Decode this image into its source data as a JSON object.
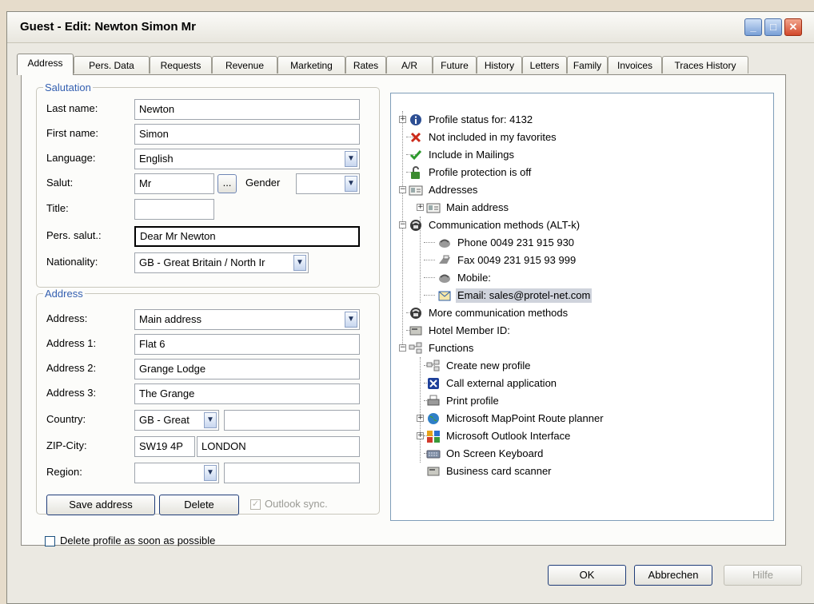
{
  "window": {
    "title": "Guest - Edit: Newton Simon Mr"
  },
  "tabs": [
    "Address",
    "Pers. Data",
    "Requests",
    "Revenue",
    "Marketing",
    "Rates",
    "A/R",
    "Future",
    "History",
    "Letters",
    "Family",
    "Invoices",
    "Traces History"
  ],
  "active_tab": "Address",
  "salutation": {
    "legend": "Salutation",
    "last_name": {
      "label": "Last name:",
      "value": "Newton"
    },
    "first_name": {
      "label": "First name:",
      "value": "Simon"
    },
    "language": {
      "label": "Language:",
      "value": "English"
    },
    "salut": {
      "label": "Salut:",
      "value": "Mr",
      "picker": "..."
    },
    "gender": {
      "label": "Gender",
      "value": ""
    },
    "title": {
      "label": "Title:",
      "value": ""
    },
    "pers_salut": {
      "label": "Pers. salut.:",
      "value": "Dear Mr Newton"
    },
    "nationality": {
      "label": "Nationality:",
      "value": "GB - Great Britain / North Ir"
    }
  },
  "address": {
    "legend": "Address",
    "address_select": {
      "label": "Address:",
      "value": "Main address"
    },
    "address1": {
      "label": "Address 1:",
      "value": "Flat 6"
    },
    "address2": {
      "label": "Address 2:",
      "value": "Grange Lodge"
    },
    "address3": {
      "label": "Address 3:",
      "value": "The Grange"
    },
    "country": {
      "label": "Country:",
      "value": "GB - Great",
      "extra": ""
    },
    "zip_city": {
      "label": "ZIP-City:",
      "zip": "SW19 4P",
      "city": "LONDON"
    },
    "region": {
      "label": "Region:",
      "value": "",
      "extra": ""
    },
    "save_label": "Save address",
    "delete_label": "Delete",
    "outlook_sync": {
      "label": "Outlook sync.",
      "checked": true
    }
  },
  "delete_profile": {
    "label": "Delete profile as soon as possible",
    "checked": false
  },
  "tree": {
    "profile_status": "Profile status for: 4132",
    "not_favorites": "Not included in my favorites",
    "mailings": "Include in Mailings",
    "protection": "Profile protection is off",
    "addresses": "Addresses",
    "main_address": "Main address",
    "comm_methods": "Communication methods (ALT-k)",
    "phone": "Phone 0049 231 915 930",
    "fax": "Fax 0049 231 915 93 999",
    "mobile": "Mobile:",
    "email": "Email: sales@protel-net.com",
    "more_comm": "More communication methods",
    "hotel_member": "Hotel Member ID:",
    "functions": "Functions",
    "create_profile": "Create new profile",
    "call_external": "Call external application",
    "print_profile": "Print profile",
    "mappoint": "Microsoft MapPoint Route planner",
    "outlook": "Microsoft Outlook Interface",
    "keyboard": "On Screen Keyboard",
    "card_scanner": "Business card scanner"
  },
  "footer": {
    "ok": "OK",
    "cancel": "Abbrechen",
    "help": "Hilfe"
  },
  "colors": {
    "legend": "#335fb0",
    "selection": "#cfd3dc",
    "close_button": "#d2492b",
    "window_bg": "#ebe9e2"
  }
}
